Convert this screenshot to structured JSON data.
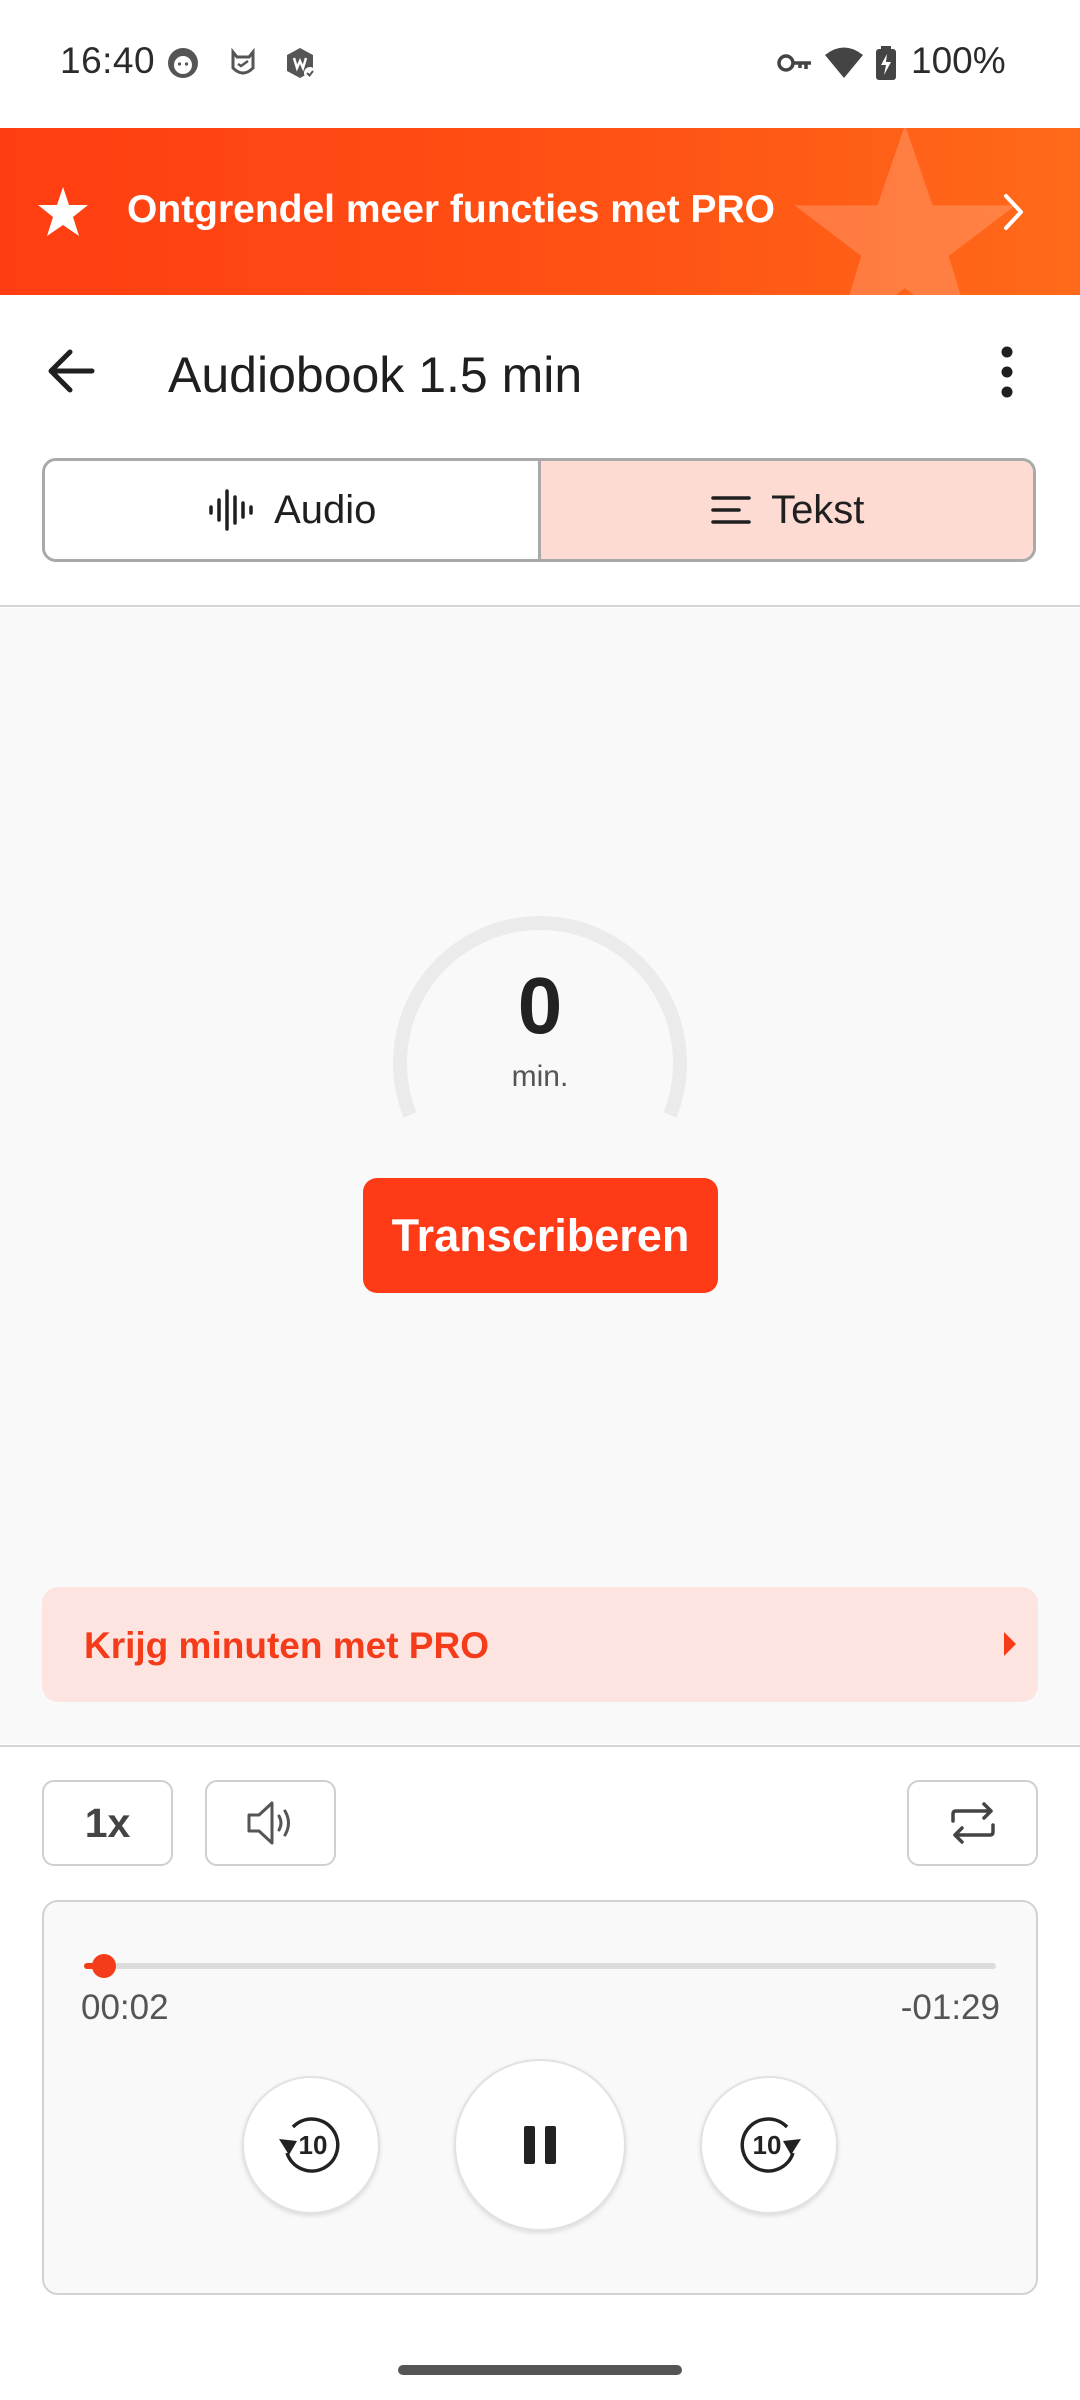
{
  "status_bar": {
    "time": "16:40",
    "battery": "100%",
    "icons": [
      "cat-face-icon",
      "mi-icon",
      "app-badge-icon",
      "vpn-key-icon",
      "wifi-icon",
      "battery-charging-icon"
    ]
  },
  "promo": {
    "text": "Ontgrendel meer functies met PRO",
    "icon": "star-icon"
  },
  "app_bar": {
    "title": "Audiobook 1.5 min"
  },
  "tabs": [
    {
      "label": "Audio",
      "icon": "waveform-icon",
      "selected": false
    },
    {
      "label": "Tekst",
      "icon": "text-lines-icon",
      "selected": true
    }
  ],
  "transcription": {
    "minutes_value": "0",
    "minutes_unit": "min.",
    "button_label": "Transcriberen"
  },
  "pro_bar": {
    "text": "Krijg minuten met PRO"
  },
  "controls": {
    "speed": "1x"
  },
  "player": {
    "current_time": "00:02",
    "remaining_time": "-01:29",
    "progress": 0.022,
    "rewind_seconds": "10",
    "forward_seconds": "10"
  },
  "colors": {
    "accent": "#ff3a17",
    "tab_selected_bg": "#fddbd3",
    "pro_bar_bg": "#fde4e1"
  }
}
